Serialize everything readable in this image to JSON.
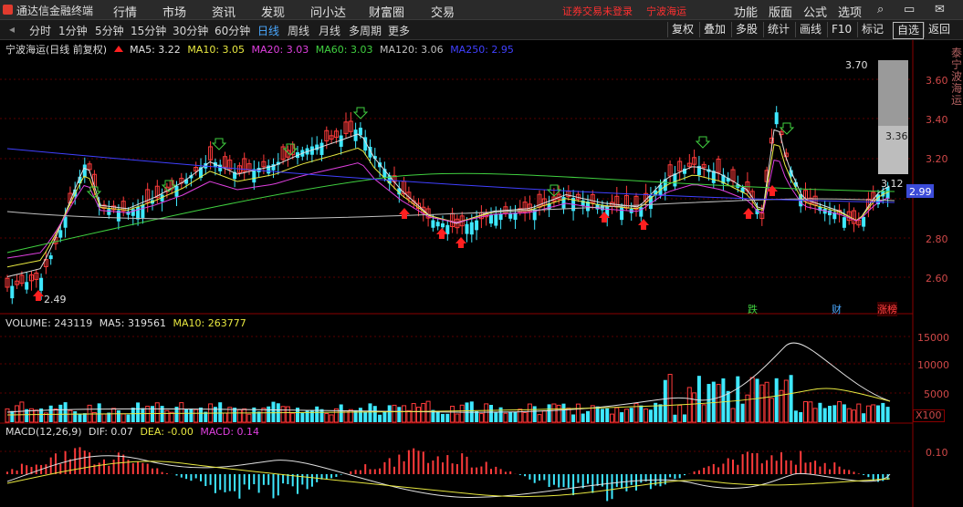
{
  "app": {
    "title": "通达信金融终端"
  },
  "menu": [
    "行情",
    "市场",
    "资讯",
    "发现",
    "问小达",
    "财富圈",
    "交易"
  ],
  "login_status": "证券交易未登录",
  "current_stock": "宁波海运",
  "right_menu": [
    "功能",
    "版面",
    "公式",
    "选项"
  ],
  "periods": [
    "分时",
    "1分钟",
    "5分钟",
    "15分钟",
    "30分钟",
    "60分钟",
    "日线",
    "周线",
    "月线",
    "多周期",
    "更多"
  ],
  "active_period": "日线",
  "right_buttons": [
    "复权",
    "叠加",
    "多股",
    "统计",
    "画线",
    "F10",
    "标记",
    "自选",
    "返回"
  ],
  "main_legend": {
    "title": "宁波海运(日线 前复权)",
    "items": [
      {
        "label": "MA5: 3.22",
        "color": "#e0e0e0"
      },
      {
        "label": "MA10: 3.05",
        "color": "#e8e840"
      },
      {
        "label": "MA20: 3.03",
        "color": "#e040e0"
      },
      {
        "label": "MA60: 3.03",
        "color": "#40d040"
      },
      {
        "label": "MA120: 3.06",
        "color": "#c0c0c0"
      },
      {
        "label": "MA250: 2.95",
        "color": "#4040ff"
      }
    ]
  },
  "price_axis": [
    "3.60",
    "3.40",
    "3.20",
    "2.80",
    "2.60"
  ],
  "price_labels": {
    "low": "2.49",
    "high": "3.70",
    "mid": "3.36",
    "last": "3.12",
    "current": "2.99"
  },
  "event_tags": [
    {
      "label": "跌",
      "color": "#40d040"
    },
    {
      "label": "财",
      "color": "#4aa8ff"
    },
    {
      "label": "涨榜",
      "color": "#ff4040"
    }
  ],
  "right_vertical_text": "泰宁波海运",
  "volume_legend": {
    "title": "VOLUME: 243119",
    "items": [
      {
        "label": "MA5: 319561",
        "color": "#e0e0e0"
      },
      {
        "label": "MA10: 263777",
        "color": "#e8e840"
      }
    ]
  },
  "volume_axis": [
    "15000",
    "10000",
    "5000"
  ],
  "volume_unit": "X100",
  "macd_legend": {
    "title": "MACD(12,26,9)",
    "items": [
      {
        "label": "DIF: 0.07",
        "color": "#e0e0e0"
      },
      {
        "label": "DEA: -0.00",
        "color": "#e8e840"
      },
      {
        "label": "MACD: 0.14",
        "color": "#e040e0"
      }
    ]
  },
  "macd_axis": [
    "0.10"
  ],
  "colors": {
    "up": "#ff3b3b",
    "down": "#3ee8ff",
    "grid": "#5a0000",
    "axis": "#8b0000"
  }
}
